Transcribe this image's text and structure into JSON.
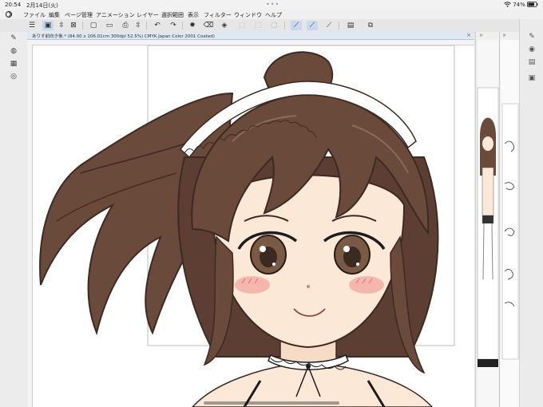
{
  "status_bar": {
    "time": "20:54",
    "date": "2月14日(火)",
    "battery": "74%"
  },
  "menu": {
    "items": [
      "ファイル",
      "編集",
      "ページ管理",
      "アニメーション",
      "レイヤー",
      "選択範囲",
      "表示",
      "フィルター",
      "ウィンドウ",
      "ヘルプ"
    ]
  },
  "document_tab": {
    "title": "ありす前向き後.* (84.00 x 106.01cm 300dpi 52.5%)  CMYK Japan Color 2001 Coated)",
    "close": "×"
  },
  "side_tabs": {
    "close_1": "×",
    "close_2": "×"
  },
  "colors": {
    "hair": "#6a4a3a",
    "hair_dark": "#3d2a22",
    "skin": "#fbe8d6",
    "blush": "#f3a6a0",
    "eye": "#7a5a44",
    "accent": "#4a76c4"
  },
  "icons": {
    "app": "cloud-app-icon",
    "wifi": "wifi-icon",
    "battery": "battery-icon"
  }
}
